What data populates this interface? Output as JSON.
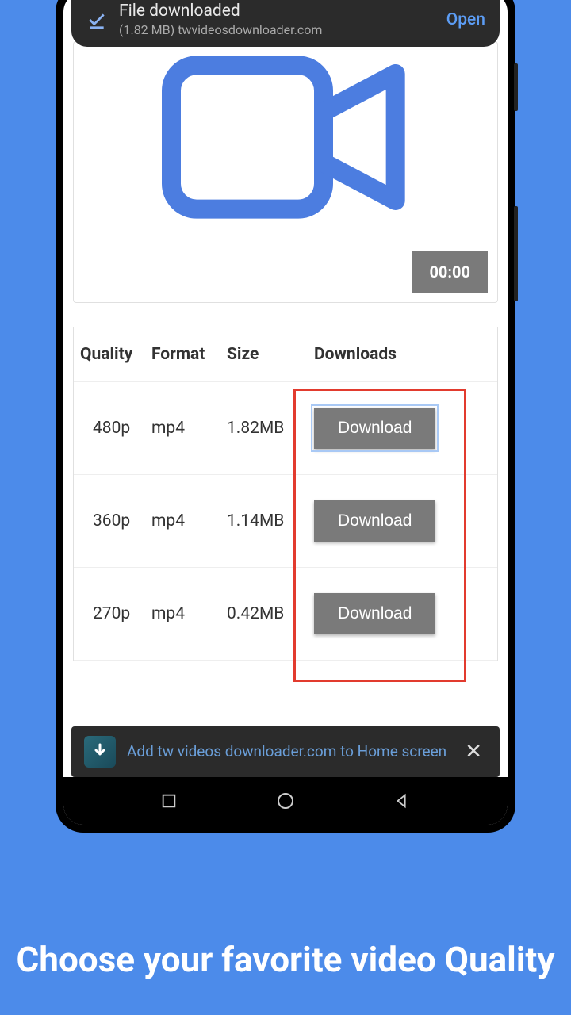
{
  "notification": {
    "title": "File downloaded",
    "subtitle": "(1.82 MB) twvideosdownloader.com",
    "action": "Open"
  },
  "video": {
    "timestamp": "00:00"
  },
  "table": {
    "headers": {
      "quality": "Quality",
      "format": "Format",
      "size": "Size",
      "downloads": "Downloads"
    },
    "rows": [
      {
        "quality": "480p",
        "format": "mp4",
        "size": "1.82MB",
        "button": "Download"
      },
      {
        "quality": "360p",
        "format": "mp4",
        "size": "1.14MB",
        "button": "Download"
      },
      {
        "quality": "270p",
        "format": "mp4",
        "size": "0.42MB",
        "button": "Download"
      }
    ]
  },
  "addHome": {
    "text": "Add tw videos downloader.com to Home screen"
  },
  "caption": "Choose your favorite video Quality"
}
